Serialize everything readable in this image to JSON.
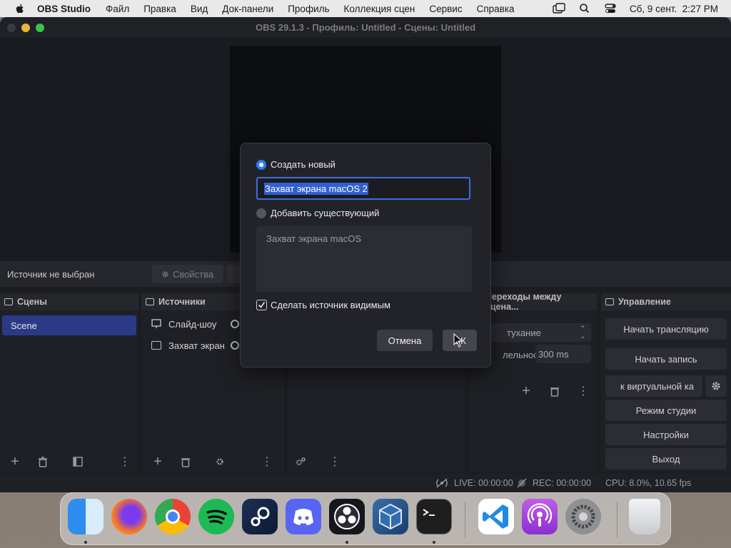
{
  "menubar": {
    "app_name": "OBS Studio",
    "items": [
      "Файл",
      "Правка",
      "Вид",
      "Док-панели",
      "Профиль",
      "Коллекция сцен",
      "Сервис",
      "Справка"
    ],
    "datetime": "Сб, 9 сент.  2:27 PM"
  },
  "window": {
    "title": "OBS 29.1.3 - Профиль: Untitled - Сцены: Untitled"
  },
  "source_toolbar": {
    "no_source": "Источник не выбран",
    "properties": "Свойства"
  },
  "scenes": {
    "header": "Сцены",
    "items": [
      "Scene"
    ]
  },
  "sources": {
    "header": "Источники",
    "items": [
      "Слайд-шоу",
      "Захват экран"
    ]
  },
  "transitions": {
    "header": "Переходы между сцена...",
    "transition": "тухание",
    "duration_label": "лельность",
    "duration": "300 ms"
  },
  "controls": {
    "header": "Управление",
    "start_stream": "Начать трансляцию",
    "start_record": "Начать запись",
    "virtual_cam": "к виртуальной ка",
    "studio_mode": "Режим студии",
    "settings": "Настройки",
    "exit": "Выход"
  },
  "status": {
    "live": "LIVE: 00:00:00",
    "rec": "REC: 00:00:00",
    "cpu": "CPU: 8.0%, 10.65 fps"
  },
  "dialog": {
    "create_new": "Создать новый",
    "name_value": "Захват экрана macOS 2",
    "add_existing": "Добавить существующий",
    "existing_items": [
      "Захват экрана macOS"
    ],
    "make_visible": "Сделать источник видимым",
    "cancel": "Отмена",
    "ok": "ОК"
  },
  "dock": {
    "apps": [
      "finder-icon",
      "firefox-icon",
      "chrome-icon",
      "spotify-icon",
      "steam-icon",
      "discord-icon",
      "obs-icon",
      "virtualbox-icon",
      "terminal-icon",
      "vscode-icon",
      "podcasts-icon",
      "system-settings-icon",
      "trash-icon"
    ]
  },
  "colors": {
    "accent": "#2d7cf6",
    "scene_selected": "#2b3a86",
    "window_bg": "#1c1d21"
  }
}
